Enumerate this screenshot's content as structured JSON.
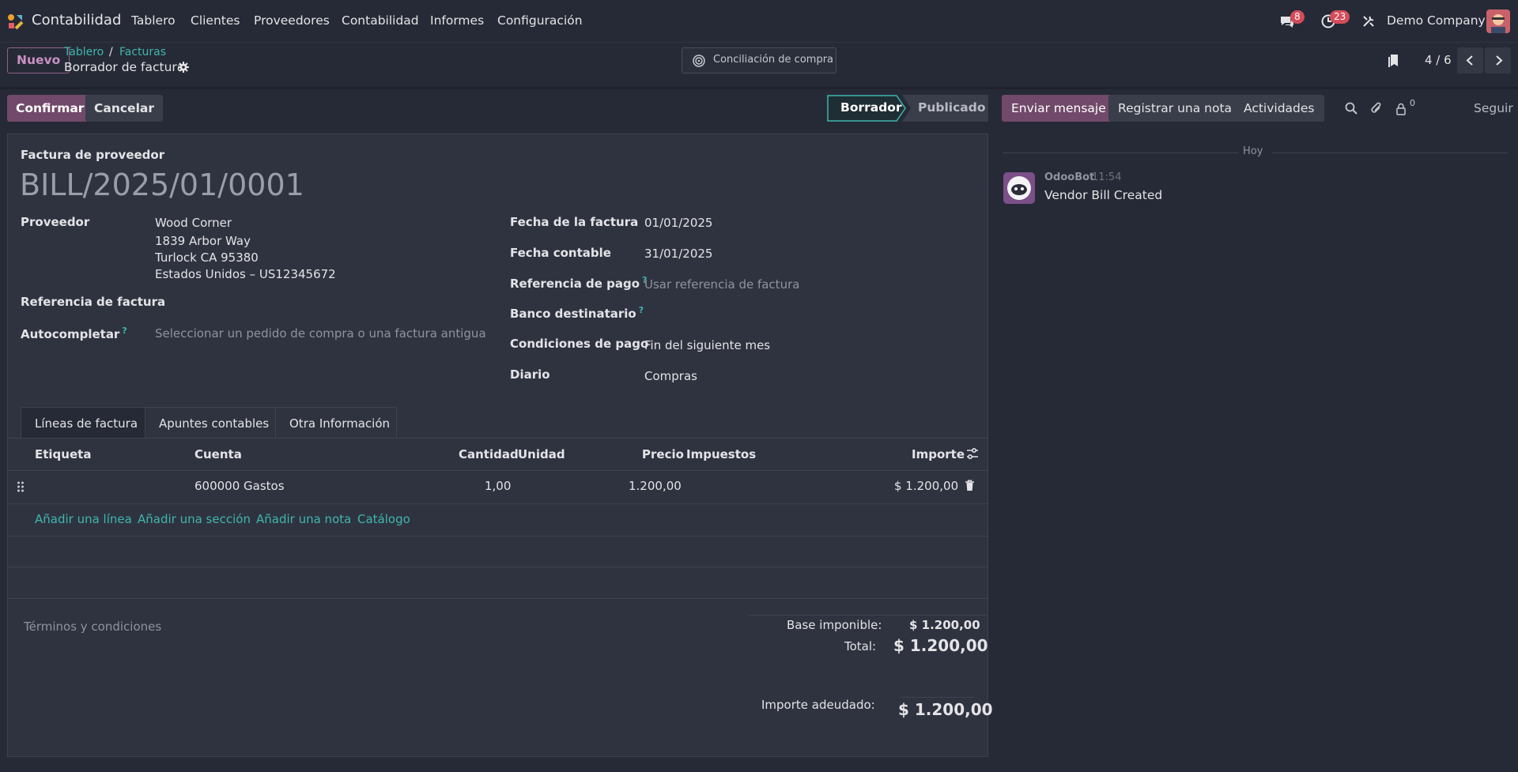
{
  "app": {
    "name": "Contabilidad"
  },
  "nav": {
    "items": [
      "Tablero",
      "Clientes",
      "Proveedores",
      "Contabilidad",
      "Informes",
      "Configuración"
    ]
  },
  "systray": {
    "messages_count": "8",
    "activities_count": "23",
    "company": "Demo Company"
  },
  "control": {
    "new_label": "Nuevo",
    "breadcrumb": [
      "Tablero",
      "Facturas"
    ],
    "record_title": "Borrador de factura",
    "smart_button": "Conciliación de compra",
    "pager": "4 / 6"
  },
  "actions": {
    "confirm": "Confirmar",
    "cancel": "Cancelar"
  },
  "status": {
    "stages": [
      "Borrador",
      "Publicado"
    ],
    "current": "Borrador"
  },
  "form": {
    "type_label": "Factura de proveedor",
    "name": "BILL/2025/01/0001",
    "vendor_label": "Proveedor",
    "vendor_lines": [
      "Wood Corner",
      "1839 Arbor Way",
      "Turlock CA 95380",
      "Estados Unidos – US12345672"
    ],
    "bill_ref_label": "Referencia de factura",
    "autocomplete_label": "Autocompletar",
    "autocomplete_placeholder": "Seleccionar un pedido de compra o una factura antigua",
    "invoice_date_label": "Fecha de la factura",
    "invoice_date": "01/01/2025",
    "accounting_date_label": "Fecha contable",
    "accounting_date": "31/01/2025",
    "payment_ref_label": "Referencia de pago",
    "payment_ref_placeholder": "Usar referencia de factura",
    "bank_label": "Banco destinatario",
    "terms_label": "Condiciones de pago",
    "terms": "Fin del siguiente mes",
    "journal_label": "Diario",
    "journal": "Compras",
    "help_mark": "?"
  },
  "tabs": [
    "Líneas de factura",
    "Apuntes contables",
    "Otra Información"
  ],
  "lines": {
    "headers": {
      "label": "Etiqueta",
      "account": "Cuenta",
      "qty": "Cantidad",
      "uom": "Unidad",
      "price": "Precio",
      "taxes": "Impuestos",
      "amount": "Importe"
    },
    "rows": [
      {
        "label": "",
        "account": "600000 Gastos",
        "qty": "1,00",
        "uom": "",
        "price": "1.200,00",
        "taxes": "",
        "amount": "$ 1.200,00"
      }
    ],
    "add_links": [
      "Añadir una línea",
      "Añadir una sección",
      "Añadir una nota",
      "Catálogo"
    ]
  },
  "footer": {
    "terms_placeholder": "Términos y condiciones",
    "untaxed_label": "Base imponible:",
    "untaxed": "$ 1.200,00",
    "total_label": "Total:",
    "total": "$ 1.200,00",
    "due_label": "Importe adeudado:",
    "due": "$ 1.200,00"
  },
  "chatter": {
    "send_message": "Enviar mensaje",
    "log_note": "Registrar una nota",
    "activities": "Actividades",
    "followers_count": "0",
    "follow": "Seguir",
    "date_separator": "Hoy",
    "messages": [
      {
        "author": "OdooBot",
        "time": "11:54",
        "body": "Vendor Bill Created"
      }
    ]
  },
  "colors": {
    "primary": "#71496a",
    "link": "#3fb6ad",
    "background": "#262a36",
    "sheet": "#2f3340",
    "badge": "#d44c59"
  }
}
